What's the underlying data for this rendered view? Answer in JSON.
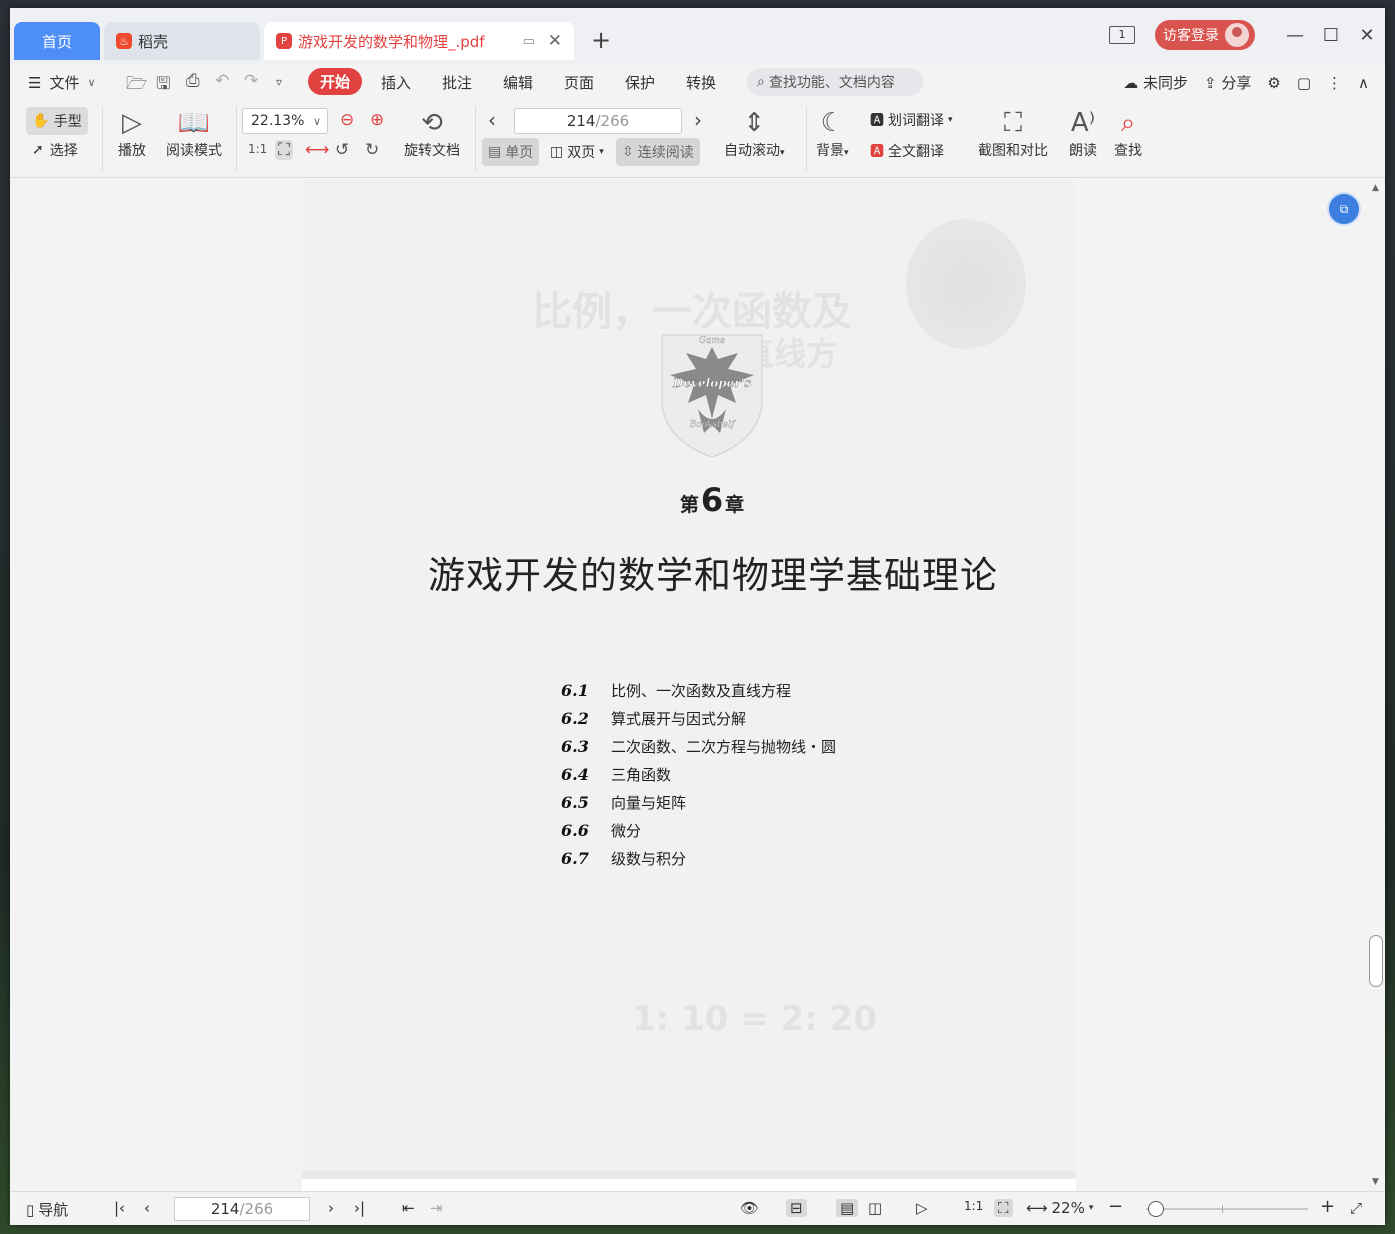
{
  "tabs": {
    "home": "首页",
    "daoke": "稻壳",
    "document": "游戏开发的数学和物理_.pdf"
  },
  "titlebar": {
    "window_count": "1",
    "login": "访客登录"
  },
  "menu": {
    "file": "文件",
    "tabs": [
      "开始",
      "插入",
      "批注",
      "编辑",
      "页面",
      "保护",
      "转换"
    ],
    "search_placeholder": "查找功能、文档内容",
    "sync": "未同步",
    "share": "分享"
  },
  "toolbar": {
    "hand": "手型",
    "select": "选择",
    "play": "播放",
    "reading_mode": "阅读模式",
    "zoom": "22.13%",
    "rotate": "旋转文档",
    "page_current": "214",
    "page_total": "/266",
    "single": "单页",
    "double": "双页",
    "continuous": "连续阅读",
    "auto_scroll": "自动滚动",
    "background": "背景",
    "word_translate": "划词翻译",
    "full_translate": "全文翻译",
    "screenshot_compare": "截图和对比",
    "read_aloud": "朗读",
    "find": "查找"
  },
  "document": {
    "logo_top": "Game",
    "logo_mid": "Developer's",
    "logo_bottom": "Bookshelf",
    "chapter_prefix": "第",
    "chapter_number": "6",
    "chapter_suffix": "章",
    "title": "游戏开发的数学和物理学基础理论",
    "toc": [
      {
        "num": "6.1",
        "title": "比例、一次函数及直线方程"
      },
      {
        "num": "6.2",
        "title": "算式展开与因式分解"
      },
      {
        "num": "6.3",
        "title": "二次函数、二次方程与抛物线・圆"
      },
      {
        "num": "6.4",
        "title": "三角函数"
      },
      {
        "num": "6.5",
        "title": "向量与矩阵"
      },
      {
        "num": "6.6",
        "title": "微分"
      },
      {
        "num": "6.7",
        "title": "级数与积分"
      }
    ]
  },
  "statusbar": {
    "nav": "导航",
    "page_current": "214",
    "page_total": "/266",
    "zoom": "22%"
  },
  "colors": {
    "accent": "#e2423f",
    "home_tab": "#4e8ef7",
    "float_button": "#3c7fe0"
  },
  "icons": [
    "menu-icon",
    "open-folder-icon",
    "save-icon",
    "print-icon",
    "undo-icon",
    "redo-icon",
    "hand-icon",
    "cursor-icon",
    "play-icon",
    "book-icon",
    "zoom-out-icon",
    "zoom-in-icon",
    "rotate-icon",
    "moon-icon",
    "translate-icon",
    "screenshot-icon",
    "read-aloud-icon",
    "search-icon",
    "settings-icon",
    "comment-icon",
    "more-icon",
    "collapse-icon",
    "eye-icon",
    "close-icon",
    "minimize-icon",
    "maximize-icon"
  ]
}
